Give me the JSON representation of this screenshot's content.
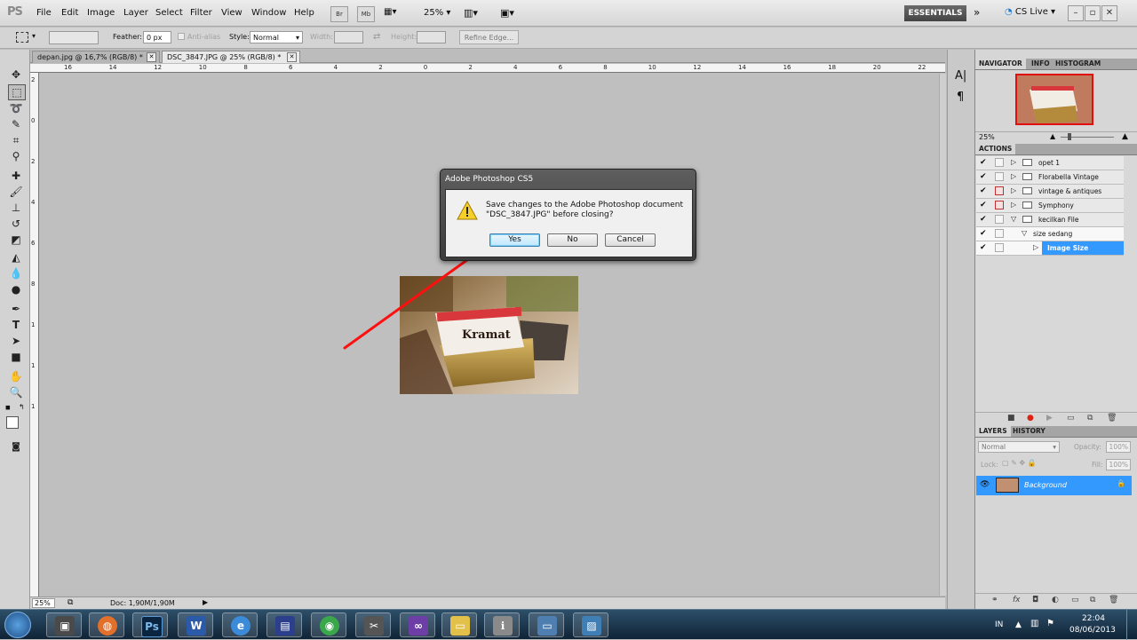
{
  "app": {
    "logo": "PS"
  },
  "menu": [
    "File",
    "Edit",
    "Image",
    "Layer",
    "Select",
    "Filter",
    "View",
    "Window",
    "Help"
  ],
  "appbar": {
    "bridge": "Br",
    "minibridge": "Mb",
    "zoom": "25%",
    "workspace": "ESSENTIALS",
    "cs_live": "CS Live"
  },
  "options": {
    "feather_label": "Feather:",
    "feather_value": "0 px",
    "antialias_label": "Anti-alias",
    "style_label": "Style:",
    "style_value": "Normal",
    "width_label": "Width:",
    "height_label": "Height:",
    "refine_edge": "Refine Edge..."
  },
  "tabs": [
    {
      "label": "depan.jpg @ 16,7% (RGB/8) *"
    },
    {
      "label": "DSC_3847.JPG @ 25% (RGB/8) *"
    }
  ],
  "ruler": {
    "h_numbers": [
      "16",
      "14",
      "12",
      "10",
      "8",
      "6",
      "4",
      "2",
      "0",
      "2",
      "4",
      "6",
      "8",
      "10",
      "12",
      "14",
      "16",
      "18",
      "20",
      "22"
    ],
    "v_numbers": [
      "2",
      "0",
      "2",
      "4",
      "6",
      "8",
      "1",
      "1",
      "1"
    ]
  },
  "dialog": {
    "title": "Adobe Photoshop CS5",
    "message_line1": "Save changes to the Adobe Photoshop document",
    "message_line2": "\"DSC_3847.JPG\" before closing?",
    "yes": "Yes",
    "no": "No",
    "cancel": "Cancel"
  },
  "photo": {
    "brand_text": "Kramat"
  },
  "status": {
    "zoom": "25%",
    "doc": "Doc: 1,90M/1,90M"
  },
  "navigator": {
    "tabs": [
      "NAVIGATOR",
      "INFO",
      "HISTOGRAM"
    ],
    "zoom": "25%"
  },
  "actions": {
    "header": "ACTIONS",
    "items": [
      {
        "label": "opet 1",
        "expanded": false,
        "dialog": false
      },
      {
        "label": "Florabella Vintage",
        "expanded": false,
        "dialog": false
      },
      {
        "label": "vintage & antiques",
        "expanded": false,
        "dialog": true
      },
      {
        "label": "Symphony",
        "expanded": false,
        "dialog": true
      },
      {
        "label": "kecilkan File",
        "expanded": true,
        "dialog": false
      },
      {
        "label": "size sedang",
        "expanded": true,
        "dialog": false
      },
      {
        "label": "Image Size",
        "expanded": false,
        "dialog": false,
        "selected": true
      }
    ]
  },
  "layers": {
    "tabs": [
      "LAYERS",
      "HISTORY"
    ],
    "blend_mode": "Normal",
    "opacity_label": "Opacity:",
    "opacity": "100%",
    "lock_label": "Lock:",
    "fill_label": "Fill:",
    "fill": "100%",
    "layer_name": "Background"
  },
  "taskbar": {
    "lang": "IN",
    "time": "22:04",
    "date": "08/06/2013",
    "apps": [
      "start",
      "computer",
      "firefox",
      "photoshop",
      "word",
      "ie",
      "vlc",
      "media-player",
      "windows-shield",
      "file-explorer",
      "setup",
      "visual-studio",
      "folder",
      "system-info",
      "monitor",
      "pictures"
    ]
  },
  "colors": {
    "accent_blue": "#3399ff",
    "arrow_red": "#ff1010",
    "taskbar": "#1a3550"
  }
}
